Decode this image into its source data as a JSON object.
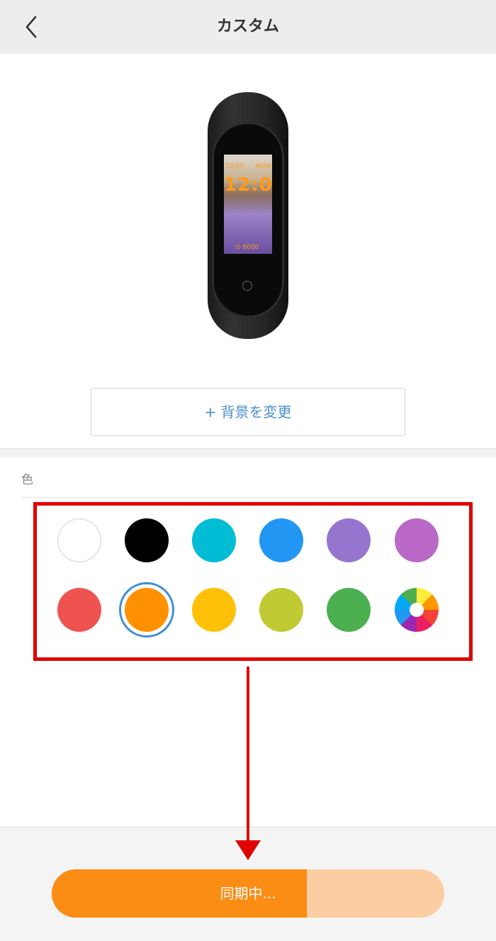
{
  "header": {
    "title": "カスタム",
    "back_icon": "chevron-left-icon"
  },
  "preview": {
    "band_screen": {
      "date": "10/25",
      "day": "MON",
      "time": "12:00",
      "steps": "8000"
    }
  },
  "change_background_button": {
    "label": "+ 背景を変更"
  },
  "color_section": {
    "label": "色",
    "selected": "orange",
    "swatches": [
      {
        "name": "white",
        "color": "#ffffff"
      },
      {
        "name": "black",
        "color": "#000000"
      },
      {
        "name": "cyan",
        "color": "#00bcd4"
      },
      {
        "name": "blue",
        "color": "#2196f3"
      },
      {
        "name": "lavender",
        "color": "#9575cd"
      },
      {
        "name": "purple",
        "color": "#ba68c8"
      },
      {
        "name": "red",
        "color": "#ef5350"
      },
      {
        "name": "orange",
        "color": "#ff9100"
      },
      {
        "name": "amber",
        "color": "#ffc107"
      },
      {
        "name": "lime",
        "color": "#c0ca33"
      },
      {
        "name": "green",
        "color": "#4caf50"
      },
      {
        "name": "custom",
        "color": "multicolor"
      }
    ]
  },
  "sync_button": {
    "label": "同期中...",
    "progress": 0.65,
    "fill_color": "#fb8c14",
    "track_color": "#fbcda0"
  },
  "annotation": {
    "highlight_color": "#e00000"
  }
}
